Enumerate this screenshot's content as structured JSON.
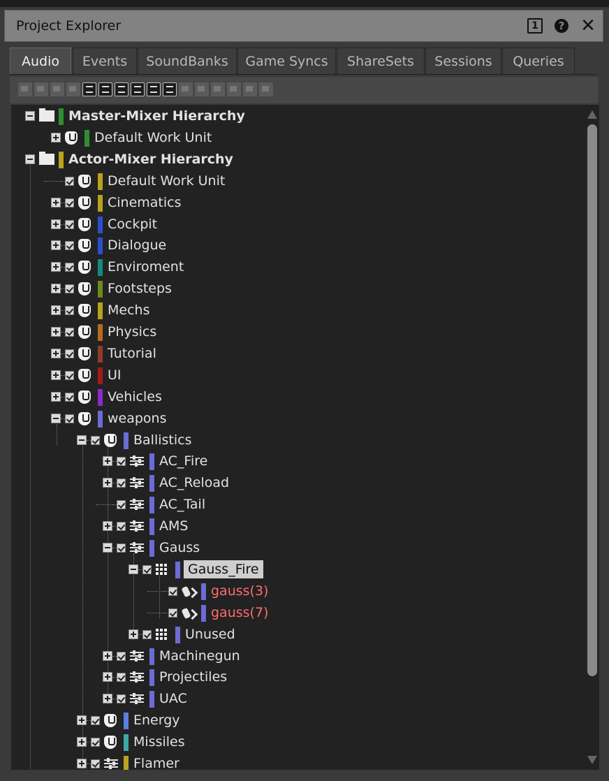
{
  "window": {
    "title": "Project Explorer",
    "btn_one": "1",
    "btn_help": "?",
    "btn_close": "✕"
  },
  "tabs": [
    {
      "label": "Audio",
      "active": true
    },
    {
      "label": "Events"
    },
    {
      "label": "SoundBanks"
    },
    {
      "label": "Game Syncs"
    },
    {
      "label": "ShareSets"
    },
    {
      "label": "Sessions"
    },
    {
      "label": "Queries"
    }
  ],
  "toolbar": {
    "buttons": [
      "work-unit",
      "folder",
      "physical-folder",
      "actor-mixer",
      "random-container",
      "sequence-container",
      "switch-container",
      "blend-container",
      "sound-sfx",
      "sound-voice",
      "music-segment",
      "music-track",
      "music-playlist",
      "music-switch",
      "audio-device",
      "unknown"
    ],
    "active": [
      4,
      5,
      6,
      7,
      8,
      9
    ]
  },
  "colors": {
    "green": "#2f8f2f",
    "gold": "#b8a21e",
    "blue": "#2b4fd0",
    "teal": "#138a7b",
    "olive": "#6d8a1d",
    "orange": "#b46c1c",
    "brown": "#8f3d2a",
    "red": "#a31c1c",
    "purple": "#8a2bc7",
    "lavender": "#6b6cd6",
    "lightblue": "#5a80e0",
    "cyan": "#3fa6a6"
  },
  "tree": [
    {
      "label": "Master-Mixer Hierarchy",
      "depth": 0,
      "type": "folder",
      "expander": "minus",
      "color": "green",
      "bold": true
    },
    {
      "label": "Default Work Unit",
      "depth": 1,
      "type": "workunit",
      "expander": "plus",
      "color": "green",
      "check": false
    },
    {
      "label": "Actor-Mixer Hierarchy",
      "depth": 0,
      "type": "folder",
      "expander": "minus",
      "color": "gold",
      "bold": true
    },
    {
      "label": "Default Work Unit",
      "depth": 1,
      "type": "workunit",
      "expander": "none",
      "color": "gold",
      "check": true
    },
    {
      "label": "Cinematics",
      "depth": 1,
      "type": "workunit",
      "expander": "plus",
      "color": "gold",
      "check": true
    },
    {
      "label": "Cockpit",
      "depth": 1,
      "type": "workunit",
      "expander": "plus",
      "color": "blue",
      "check": true
    },
    {
      "label": "Dialogue",
      "depth": 1,
      "type": "workunit",
      "expander": "plus",
      "color": "blue",
      "check": true
    },
    {
      "label": "Enviroment",
      "depth": 1,
      "type": "workunit",
      "expander": "plus",
      "color": "teal",
      "check": true
    },
    {
      "label": "Footsteps",
      "depth": 1,
      "type": "workunit",
      "expander": "plus",
      "color": "olive",
      "check": true
    },
    {
      "label": "Mechs",
      "depth": 1,
      "type": "workunit",
      "expander": "plus",
      "color": "gold",
      "check": true
    },
    {
      "label": "Physics",
      "depth": 1,
      "type": "workunit",
      "expander": "plus",
      "color": "orange",
      "check": true
    },
    {
      "label": "Tutorial",
      "depth": 1,
      "type": "workunit",
      "expander": "plus",
      "color": "brown",
      "check": true
    },
    {
      "label": "UI",
      "depth": 1,
      "type": "workunit",
      "expander": "plus",
      "color": "red",
      "check": true
    },
    {
      "label": "Vehicles",
      "depth": 1,
      "type": "workunit",
      "expander": "plus",
      "color": "purple",
      "check": true
    },
    {
      "label": "weapons",
      "depth": 1,
      "type": "workunit",
      "expander": "minus",
      "color": "lavender",
      "check": true
    },
    {
      "label": "Ballistics",
      "depth": 2,
      "type": "workunit",
      "expander": "minus",
      "color": "lavender",
      "check": true
    },
    {
      "label": "AC_Fire",
      "depth": 3,
      "type": "actormixer",
      "expander": "plus",
      "color": "lavender",
      "check": true
    },
    {
      "label": "AC_Reload",
      "depth": 3,
      "type": "actormixer",
      "expander": "plus",
      "color": "lavender",
      "check": true
    },
    {
      "label": "AC_Tail",
      "depth": 3,
      "type": "actormixer",
      "expander": "none",
      "color": "lavender",
      "check": true
    },
    {
      "label": "AMS",
      "depth": 3,
      "type": "actormixer",
      "expander": "plus",
      "color": "lavender",
      "check": true
    },
    {
      "label": "Gauss",
      "depth": 3,
      "type": "actormixer",
      "expander": "minus",
      "color": "lavender",
      "check": true
    },
    {
      "label": "Gauss_Fire",
      "depth": 4,
      "type": "container",
      "expander": "minus",
      "color": "lavender",
      "check": true,
      "selected": true
    },
    {
      "label": "gauss(3)",
      "depth": 5,
      "type": "sound",
      "expander": "none",
      "color": "lavender",
      "check": true,
      "red": true
    },
    {
      "label": "gauss(7)",
      "depth": 5,
      "type": "sound",
      "expander": "none",
      "color": "lavender",
      "check": true,
      "red": true
    },
    {
      "label": "Unused",
      "depth": 4,
      "type": "container",
      "expander": "plus",
      "color": "lavender",
      "check": true
    },
    {
      "label": "Machinegun",
      "depth": 3,
      "type": "actormixer",
      "expander": "plus",
      "color": "lavender",
      "check": true
    },
    {
      "label": "Projectiles",
      "depth": 3,
      "type": "actormixer",
      "expander": "plus",
      "color": "lavender",
      "check": true
    },
    {
      "label": "UAC",
      "depth": 3,
      "type": "actormixer",
      "expander": "plus",
      "color": "lavender",
      "check": true
    },
    {
      "label": "Energy",
      "depth": 2,
      "type": "workunit",
      "expander": "plus",
      "color": "lightblue",
      "check": true
    },
    {
      "label": "Missiles",
      "depth": 2,
      "type": "workunit",
      "expander": "plus",
      "color": "cyan",
      "check": true
    },
    {
      "label": "Flamer",
      "depth": 2,
      "type": "actormixer",
      "expander": "plus",
      "color": "gold",
      "check": true
    }
  ]
}
